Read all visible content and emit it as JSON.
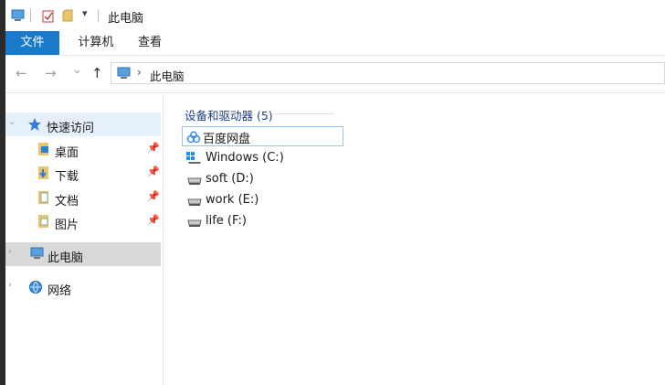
{
  "window": {
    "title": "此电脑"
  },
  "ribbon": {
    "tabs": [
      {
        "label": "文件"
      },
      {
        "label": "计算机"
      },
      {
        "label": "查看"
      }
    ]
  },
  "nav": {
    "back": "←",
    "forward": "→",
    "recent": "⌄",
    "up": "↑",
    "address": {
      "separator": "›",
      "location": "此电脑"
    }
  },
  "sidebar": {
    "quick_access": {
      "label": "快速访问"
    },
    "items": [
      {
        "label": "桌面"
      },
      {
        "label": "下载"
      },
      {
        "label": "文档"
      },
      {
        "label": "图片"
      }
    ],
    "this_pc": {
      "label": "此电脑"
    },
    "network": {
      "label": "网络"
    }
  },
  "content": {
    "group_header": "设备和驱动器 (5)",
    "drives": [
      {
        "label": "百度网盘"
      },
      {
        "label": "Windows (C:)"
      },
      {
        "label": "soft (D:)"
      },
      {
        "label": "work (E:)"
      },
      {
        "label": "life (F:)"
      }
    ]
  },
  "colors": {
    "accent": "#1979ca",
    "header_text": "#1e3f86",
    "selection_border": "#99c8ef",
    "hover_bg": "#e5f0fb",
    "active_bg": "#d9d9d9"
  }
}
